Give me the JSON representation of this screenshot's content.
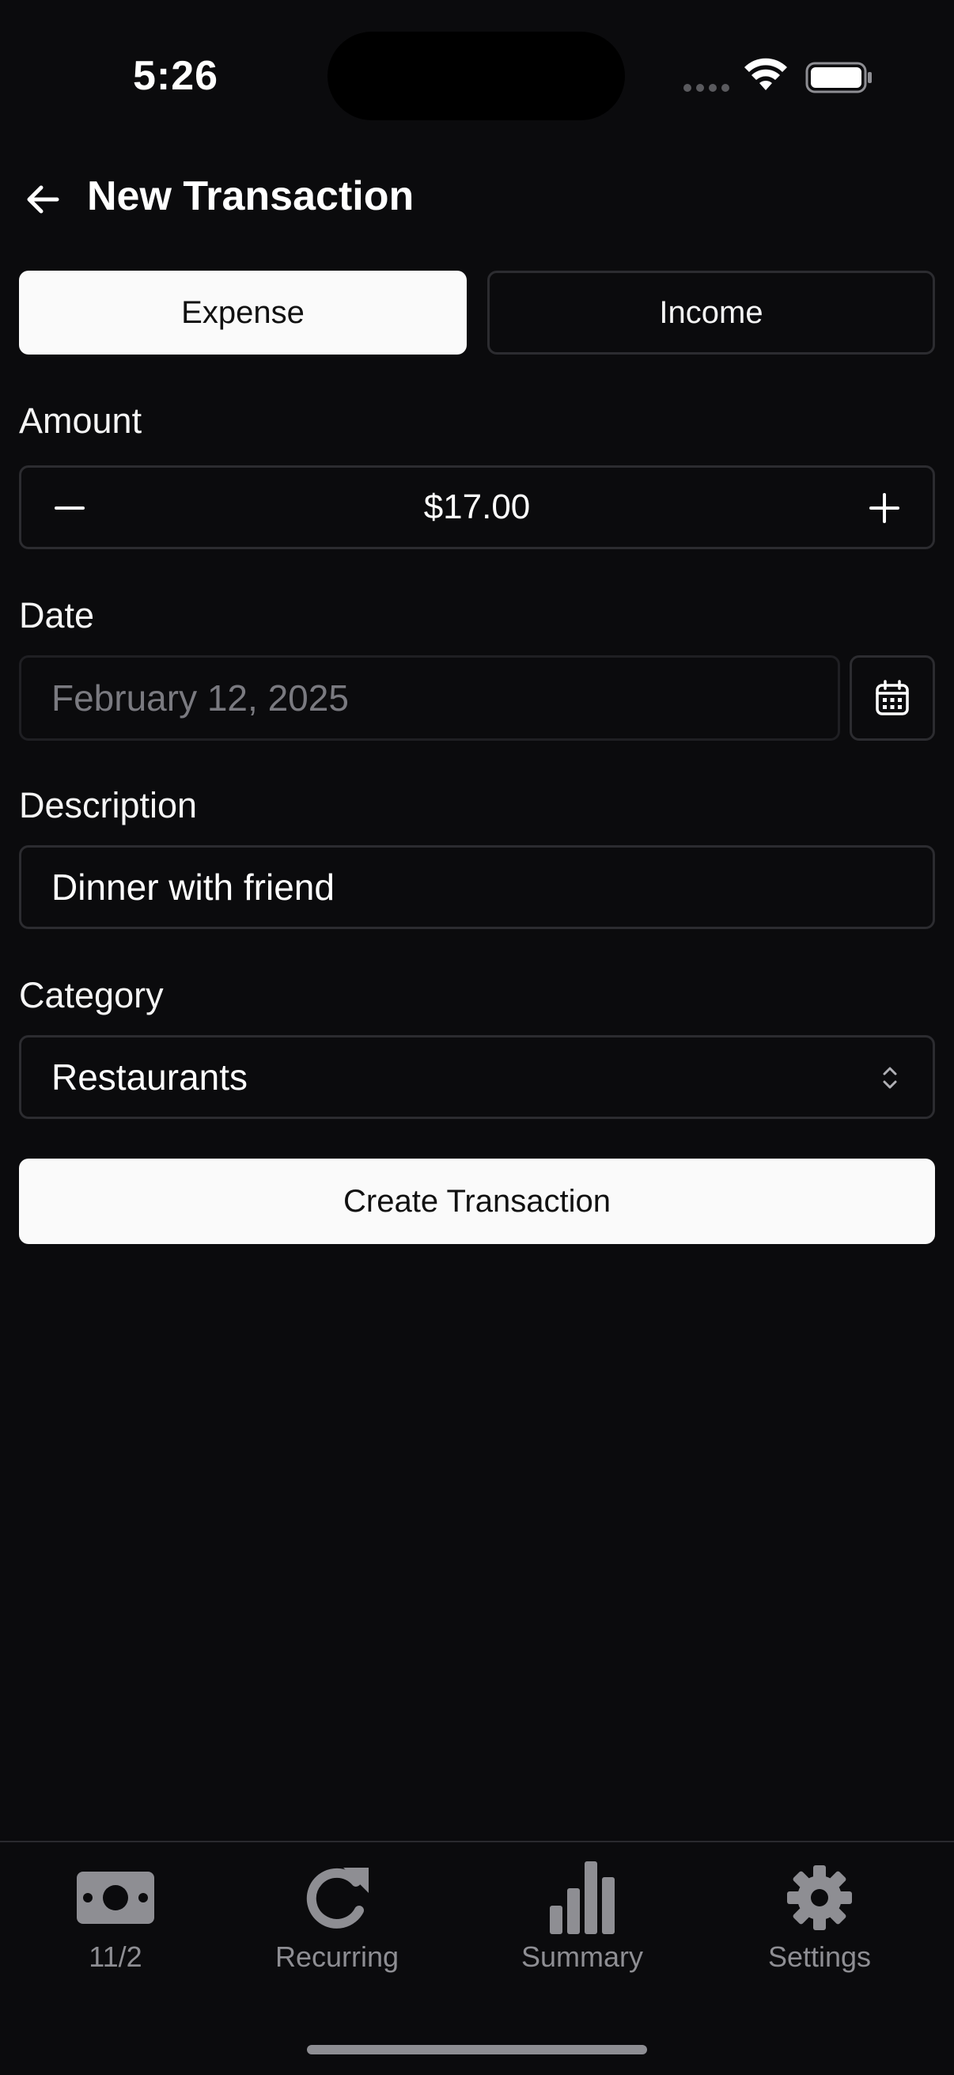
{
  "status_bar": {
    "time": "5:26"
  },
  "header": {
    "title": "New Transaction",
    "back_icon": "arrow-left-icon"
  },
  "type_toggle": {
    "options": [
      "Expense",
      "Income"
    ],
    "selected": "Expense"
  },
  "form": {
    "amount": {
      "label": "Amount",
      "value": "$17.00"
    },
    "date": {
      "label": "Date",
      "placeholder": "February 12, 2025"
    },
    "description": {
      "label": "Description",
      "value": "Dinner with friend"
    },
    "category": {
      "label": "Category",
      "value": "Restaurants"
    },
    "submit_label": "Create Transaction"
  },
  "tab_bar": {
    "items": [
      {
        "label": "11/2",
        "icon": "cash-icon"
      },
      {
        "label": "Recurring",
        "icon": "refresh-icon"
      },
      {
        "label": "Summary",
        "icon": "bar-chart-icon"
      },
      {
        "label": "Settings",
        "icon": "gear-icon"
      }
    ]
  },
  "colors": {
    "background": "#0b0b0d",
    "primary_button": "#fafafa",
    "border": "#2c2c30",
    "muted_text": "#8e8e93"
  }
}
